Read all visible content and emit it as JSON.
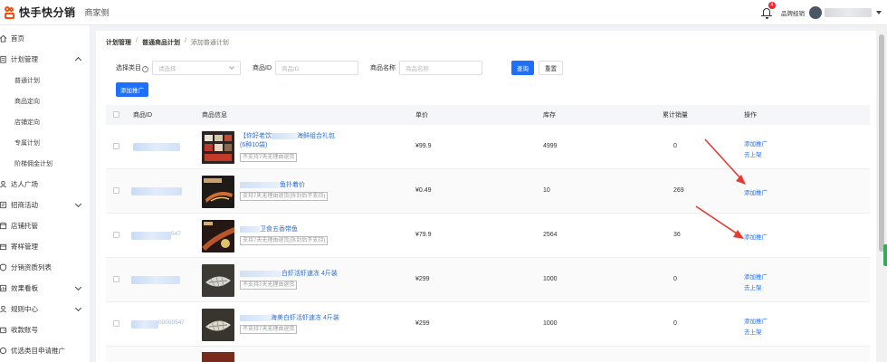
{
  "topbar": {
    "brand": "快手快分销",
    "role_label": "商家侧",
    "notification_count": "4",
    "account_role": "品牌经销"
  },
  "sidebar": {
    "items": [
      {
        "label": "首页"
      },
      {
        "label": "计划管理",
        "expanded": true,
        "children": [
          {
            "label": "普通计划"
          },
          {
            "label": "商品定向"
          },
          {
            "label": "店铺定向"
          },
          {
            "label": "专属计划"
          },
          {
            "label": "阶梯佣金计划"
          }
        ]
      },
      {
        "label": "达人广场"
      },
      {
        "label": "招商活动",
        "expandable": true
      },
      {
        "label": "店铺托管"
      },
      {
        "label": "寄样管理"
      },
      {
        "label": "分销资质列表"
      },
      {
        "label": "效果看板",
        "expandable": true
      },
      {
        "label": "规则中心",
        "expandable": true
      },
      {
        "label": "收款账号"
      },
      {
        "label": "优选类目申请推广"
      }
    ]
  },
  "breadcrumb": [
    "计划管理",
    "普通商品计划",
    "添加普通计划"
  ],
  "filters": {
    "category_label": "选择类目",
    "category_placeholder": "请选择",
    "product_id_label": "商品ID",
    "product_id_placeholder": "商品ID",
    "product_name_label": "商品名称",
    "product_name_placeholder": "商品名称",
    "query_button": "查询",
    "reset_button": "重置"
  },
  "add_promo_button": "添加推广",
  "table": {
    "columns": [
      "商品ID",
      "商品信息",
      "单价",
      "库存",
      "累计销量",
      "操作"
    ],
    "rows": [
      {
        "name_prefix": "【你好老饮",
        "name_suffix": "海鲜组合礼包",
        "name_line2": "(6种10袋)",
        "tag": "不支持7天无理由退货",
        "price": "¥99.9",
        "stock": "4999",
        "sales": "0",
        "actions": [
          "添加推广",
          "去上架"
        ]
      },
      {
        "name_prefix": "",
        "name_suffix": "鱼扑着价",
        "name_line2": "",
        "tag": "支持7天无理由退货(拆封后不支持)",
        "price": "¥0.49",
        "stock": "10",
        "sales": "269",
        "actions": [
          "添加推广"
        ]
      },
      {
        "name_prefix": "",
        "name_suffix": "卫食五香带鱼",
        "name_line2": "",
        "tag": "支持7天无理由退货(拆封后不支持)",
        "price": "¥79.9",
        "stock": "2564",
        "sales": "36",
        "actions": [
          "添加推广"
        ]
      },
      {
        "name_prefix": "",
        "name_suffix": "白虾活虾速冻 4斤装",
        "name_line2": "",
        "tag": "不支持7天无理由退货",
        "price": "¥299",
        "stock": "1000",
        "sales": "0",
        "actions": [
          "添加推广",
          "去上架"
        ]
      },
      {
        "name_prefix": "",
        "name_suffix": "海美白虾活虾速冻 4斤装",
        "name_line2": "",
        "tag": "不支持7天无理由退货",
        "price": "¥299",
        "stock": "1000",
        "sales": "0",
        "actions": [
          "添加推广",
          "去上架"
        ]
      }
    ]
  },
  "partial_ids": {
    "row3": "547",
    "row5": "00000547"
  },
  "colors": {
    "brand": "#ff4906",
    "primary": "#1f6fff",
    "link": "#2c6dd6",
    "arrow": "#e53a2f"
  }
}
